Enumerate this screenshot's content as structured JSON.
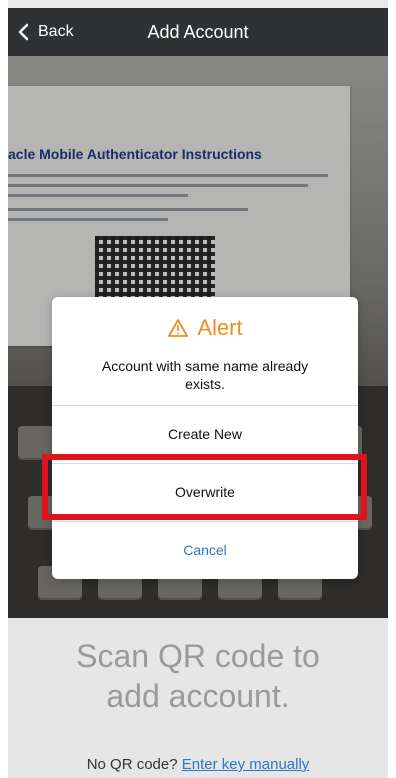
{
  "header": {
    "back_label": "Back",
    "title": "Add Account"
  },
  "camera": {
    "document_title": "acle Mobile Authenticator Instructions"
  },
  "alert": {
    "title": "Alert",
    "message": "Account with same name already exists.",
    "buttons": [
      {
        "label": "Create New"
      },
      {
        "label": "Overwrite"
      },
      {
        "label": "Cancel"
      }
    ]
  },
  "bottom": {
    "scan_line1": "Scan QR code to",
    "scan_line2": "add account.",
    "no_qr_prefix": "No QR code?",
    "enter_key_link": "Enter key manually"
  },
  "colors": {
    "header_bg": "#2f3133",
    "alert_accent": "#f08c1f",
    "link_blue": "#2b77c8",
    "highlight_red": "#e0121b"
  }
}
